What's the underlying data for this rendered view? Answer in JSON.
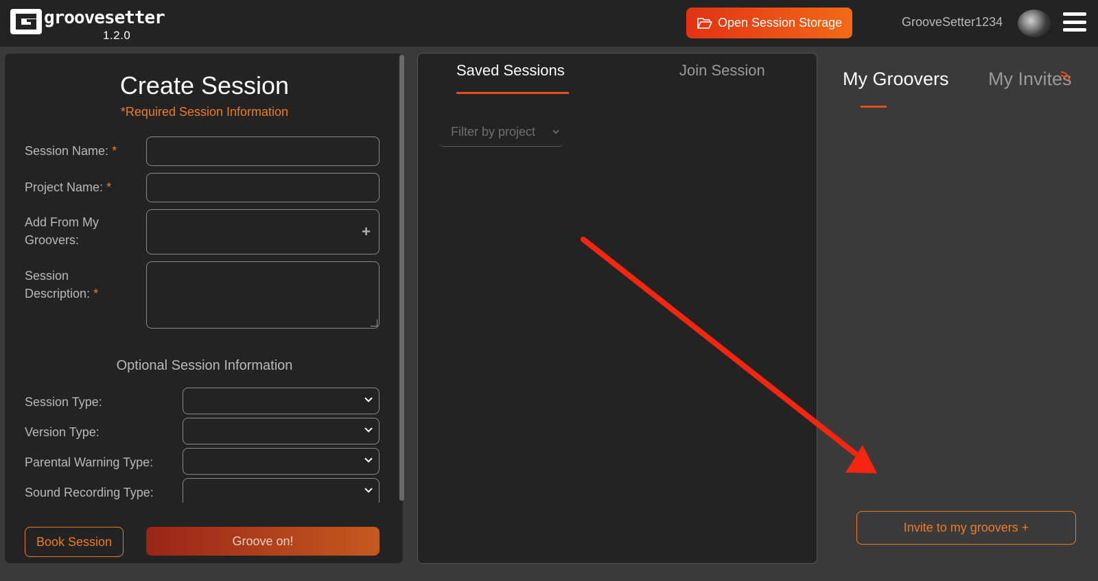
{
  "header": {
    "logo_text": "groovesetter",
    "version": "1.2.0",
    "storage_button": "Open Session Storage",
    "username": "GrooveSetter1234"
  },
  "create_session": {
    "title": "Create Session",
    "required_note": "*Required Session Information",
    "fields": {
      "session_name": "Session Name:",
      "project_name": "Project Name:",
      "add_groovers_line1": "Add From My",
      "add_groovers_line2": "Groovers:",
      "description_line1": "Session",
      "description_line2": "Description:"
    },
    "required_star": "*",
    "optional_title": "Optional Session Information",
    "selects": {
      "session_type": "Session Type:",
      "version_type": "Version Type:",
      "parental_warning_type": "Parental Warning Type:",
      "sound_recording_type": "Sound Recording Type:"
    },
    "book_button": "Book Session",
    "groove_button": "Groove on!"
  },
  "sessions": {
    "tab_saved": "Saved Sessions",
    "tab_join": "Join Session",
    "filter_placeholder": "Filter by project"
  },
  "groovers": {
    "tab_groovers": "My Groovers",
    "tab_invites": "My Invites",
    "invite_button": "Invite to my groovers +"
  },
  "colors": {
    "accent": "#f07c1e",
    "underline": "#e2501d",
    "annotation_arrow": "#f5260f"
  }
}
